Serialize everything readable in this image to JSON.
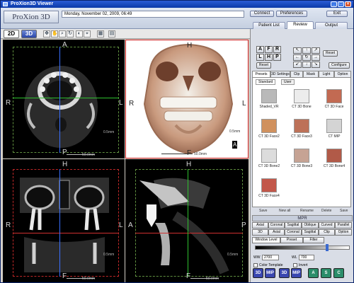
{
  "window": {
    "title": "ProXion3D Viewer",
    "minimize": "_",
    "maximize": "□",
    "close": "×"
  },
  "header": {
    "logo": "ProXion 3D",
    "patient_date": "Monday, November 02, 2009, 06:49",
    "buttons": {
      "connect": "Connect",
      "preferences": "Preferences",
      "exit": "Exit"
    },
    "tabs": [
      "Patient List",
      "Review",
      "Output"
    ],
    "active_tab": "Review"
  },
  "toolbar": {
    "mode_2d": "2D",
    "mode_3d": "3D",
    "tools": [
      "move-icon",
      "pan-icon",
      "zoom-icon",
      "rotate-icon",
      "window-level-icon",
      "measure-icon",
      "grid-icon",
      "layout-icon"
    ]
  },
  "viewports": {
    "axial": {
      "top": "A",
      "bottom": "P",
      "left": "R",
      "right": "L",
      "scale_label": "50.0mm",
      "thickness": "0.5mm"
    },
    "volume": {
      "top": "H",
      "bottom": "F",
      "left": "R",
      "right": "L",
      "orient": "A",
      "scale_label": "50.0mm",
      "thickness": "0.5mm"
    },
    "coronal": {
      "top": "H",
      "bottom": "F",
      "left": "R",
      "right": "L",
      "scale_label": "50.0mm",
      "thickness": "0.5mm"
    },
    "sagittal": {
      "top": "H",
      "bottom": "F",
      "left": "A",
      "right": "P",
      "scale_label": "50.0mm",
      "thickness": "0.5mm"
    }
  },
  "orientation_panel": {
    "grid": [
      "A",
      "F",
      "R",
      "L",
      "H",
      "P"
    ],
    "reset": "Reset",
    "arrows": [
      "↖",
      "↑",
      "↗",
      "←",
      "↻",
      "→",
      "↙",
      "↓",
      "↘"
    ],
    "reset2": "Reset",
    "configure": "Configure"
  },
  "panel_tabs": [
    "Presets",
    "3D Settings",
    "Clip",
    "Mask",
    "Light",
    "Option"
  ],
  "active_panel_tab": "Presets",
  "preset_subtabs": [
    "Standard",
    "User"
  ],
  "presets": [
    {
      "label": "Shaded_VR",
      "color": "#b9b9b9"
    },
    {
      "label": "CT 3D Bone",
      "color": "#ececec"
    },
    {
      "label": "CT 3D Face",
      "color": "#c26a52"
    },
    {
      "label": "CT 3D Face2",
      "color": "#d0915e"
    },
    {
      "label": "CT 3D Face3",
      "color": "#bd7158"
    },
    {
      "label": "CT MIP",
      "color": "#d4d4d4"
    },
    {
      "label": "CT 3D Bone2",
      "color": "#dcdcdc"
    },
    {
      "label": "CT 3D Bone3",
      "color": "#c6a394"
    },
    {
      "label": "CT 3D Bone4",
      "color": "#b15a48"
    },
    {
      "label": "CT 3D Face4",
      "color": "#c2574a"
    }
  ],
  "preset_actions": [
    "Save",
    "New all",
    "Rename",
    "Delete",
    "Save"
  ],
  "mpr": {
    "title": "MPR",
    "row1": [
      "Axial",
      "Coronal",
      "Sagittal",
      "Oblique",
      "Curved",
      "Parallel"
    ],
    "row2": [
      "3D",
      "Axial",
      "Coronal",
      "Sagittal",
      "Clip",
      "Option"
    ],
    "window_tabs": [
      "Window Level",
      "Preset",
      "Filter"
    ],
    "ww_label": "WW",
    "ww_value": "2700",
    "wl_label": "WL",
    "wl_value": "700",
    "color_template": "Color Template",
    "invert": "Invert"
  },
  "bottom_modes": [
    {
      "label": "3D",
      "color": "#3a47b0"
    },
    {
      "label": "MIP",
      "color": "#3a47b0"
    },
    {
      "label": "3D",
      "color": "#3a47b0"
    },
    {
      "label": "MIP",
      "color": "#3a47b0"
    },
    {
      "label": "A",
      "color": "#2b8d6a"
    },
    {
      "label": "S",
      "color": "#2b8d6a"
    },
    {
      "label": "C",
      "color": "#2b8d6a"
    }
  ]
}
